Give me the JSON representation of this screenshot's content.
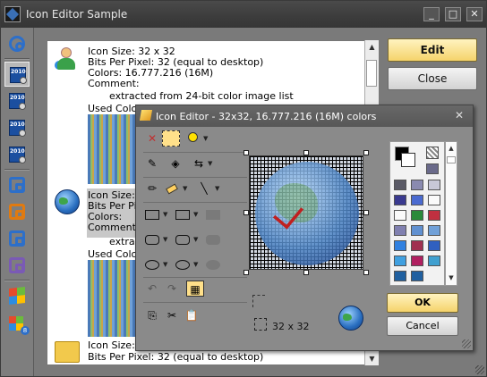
{
  "window": {
    "title": "Icon Editor Sample",
    "minimize_label": "_",
    "maximize_label": "□",
    "close_label": "✕"
  },
  "sidebar": {
    "icons": [
      "chain-icon",
      "icon-2010",
      "icon-2010",
      "icon-2010",
      "icon-2010",
      "chain-icon",
      "chain-icon",
      "chain-icon",
      "chain-icon",
      "windows-flag-icon",
      "windows-8-icon"
    ],
    "selected": 1,
    "badge_2010": "2010"
  },
  "entries": [
    {
      "icon": "user-icon",
      "lines": [
        "Icon Size:    32 x 32",
        "Bits Per Pixel:   32  (equal to desktop)",
        "Colors:   16.777.216 (16M)",
        "Comment:"
      ],
      "comment": "extracted from 24-bit color image list",
      "used_colors": "Used Colors:"
    },
    {
      "icon": "globe-icon",
      "lines": [
        "Icon Size:",
        "Bits Per Pixel:",
        "Colors:",
        "Comment:"
      ],
      "comment": "extract",
      "used_colors": "Used Colors:"
    },
    {
      "icon": "folder-icon",
      "lines": [
        "Icon Size:    32 x 32",
        "Bits Per Pixel:   32  (equal to desktop)"
      ]
    }
  ],
  "buttons": {
    "edit": "Edit",
    "close": "Close"
  },
  "dialog": {
    "title": "Icon Editor - 32x32, 16.777.216 (16M) colors",
    "close_label": "✕",
    "size_label": "32 x 32",
    "ok": "OK",
    "cancel": "Cancel",
    "colors": {
      "accent": "#f5d36b"
    }
  },
  "palette": {
    "primary": "#000000",
    "secondary": "#ffffff",
    "swatches": [
      "#5a5a66",
      "#8a8ab0",
      "#c8c8d8",
      "#3a3a90",
      "#4a6ad0",
      "#fafafa",
      "#fafafa",
      "#2a8a3a",
      "#c03040",
      "#8080b0",
      "#6090d0",
      "#70a0d8",
      "#3080e0",
      "#a03050",
      "#3060c0",
      "#40a0e0",
      "#b02060",
      "#40a0d0",
      "#2060a0",
      "#2060a0"
    ]
  }
}
